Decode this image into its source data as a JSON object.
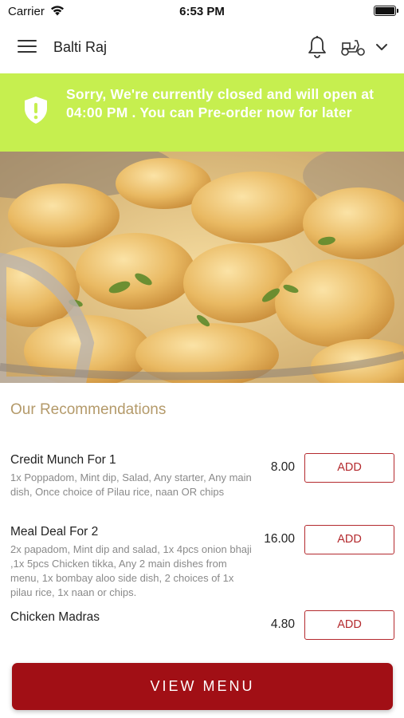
{
  "status_bar": {
    "carrier": "Carrier",
    "time": "6:53 PM",
    "wifi_icon": "wifi-icon",
    "battery_icon": "battery-icon"
  },
  "header": {
    "title": "Balti Raj",
    "menu_icon": "hamburger-menu-icon",
    "bell_icon": "bell-icon",
    "delivery_icon": "scooter-icon",
    "dropdown_icon": "chevron-down-icon"
  },
  "notice": {
    "text": "Sorry, We're currently closed and will open at 04:00 PM . You can Pre-order now for later",
    "icon": "shield-alert-icon",
    "background": "#c6ef4f"
  },
  "hero": {
    "image_icon": "food-image"
  },
  "recommendations": {
    "title": "Our Recommendations",
    "items": [
      {
        "name": "Credit Munch For 1",
        "description": "1x Poppadom, Mint dip, Salad, Any starter, Any main dish, Once choice of Pilau rice, naan OR chips",
        "price": "8.00",
        "button": "ADD"
      },
      {
        "name": "Meal Deal For 2",
        "description": "2x papadom, Mint dip and salad, 1x 4pcs onion bhaji ,1x 5pcs Chicken tikka, Any 2 main dishes from menu, 1x bombay aloo side dish, 2 choices of 1x pilau rice, 1x naan or chips.",
        "price": "16.00",
        "button": "ADD"
      },
      {
        "name": "Chicken Madras",
        "description": "",
        "price": "4.80",
        "button": "ADD"
      }
    ]
  },
  "footer": {
    "view_menu_label": "VIEW MENU",
    "accent": "#a10f15"
  }
}
